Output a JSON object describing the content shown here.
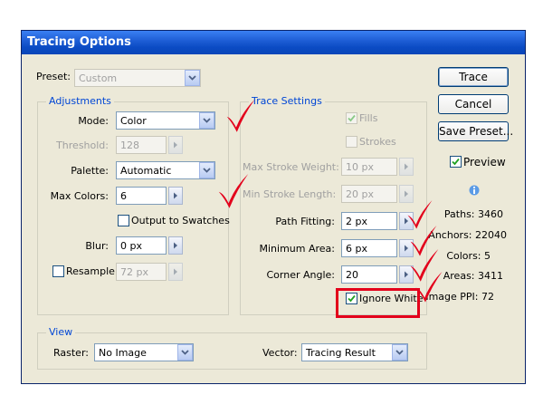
{
  "window": {
    "title": "Tracing Options"
  },
  "preset": {
    "label": "Preset:",
    "value": "Custom"
  },
  "adjustments": {
    "title": "Adjustments",
    "mode": {
      "label": "Mode:",
      "value": "Color"
    },
    "threshold": {
      "label": "Threshold:",
      "value": "128"
    },
    "palette": {
      "label": "Palette:",
      "value": "Automatic"
    },
    "max_colors": {
      "label": "Max Colors:",
      "value": "6"
    },
    "output_to_swatches": {
      "label": "Output to Swatches",
      "checked": false
    },
    "blur": {
      "label": "Blur:",
      "value": "0 px"
    },
    "resample": {
      "label": "Resample:",
      "value": "72 px",
      "checked": false
    }
  },
  "trace_settings": {
    "title": "Trace Settings",
    "fills": {
      "label": "Fills",
      "checked": true
    },
    "strokes": {
      "label": "Strokes",
      "checked": false
    },
    "max_stroke_weight": {
      "label": "Max Stroke Weight:",
      "value": "10 px"
    },
    "min_stroke_length": {
      "label": "Min Stroke Length:",
      "value": "20 px"
    },
    "path_fitting": {
      "label": "Path Fitting:",
      "value": "2 px"
    },
    "minimum_area": {
      "label": "Minimum Area:",
      "value": "6 px"
    },
    "corner_angle": {
      "label": "Corner Angle:",
      "value": "20"
    },
    "ignore_white": {
      "label": "Ignore White",
      "checked": true
    }
  },
  "view": {
    "title": "View",
    "raster": {
      "label": "Raster:",
      "value": "No Image"
    },
    "vector": {
      "label": "Vector:",
      "value": "Tracing Result"
    }
  },
  "buttons": {
    "trace": "Trace",
    "cancel": "Cancel",
    "save_preset": "Save Preset..."
  },
  "preview": {
    "label": "Preview",
    "checked": true
  },
  "stats": {
    "paths": "Paths: 3460",
    "anchors": "Anchors: 22040",
    "colors": "Colors: 5",
    "areas": "Areas: 3411",
    "image_ppi": "Image PPI: 72"
  },
  "colors": {
    "title_bar": "#0a46b8",
    "dialog_bg": "#ece9d8",
    "group_title": "#0046d5",
    "annotation": "#e3001b"
  }
}
